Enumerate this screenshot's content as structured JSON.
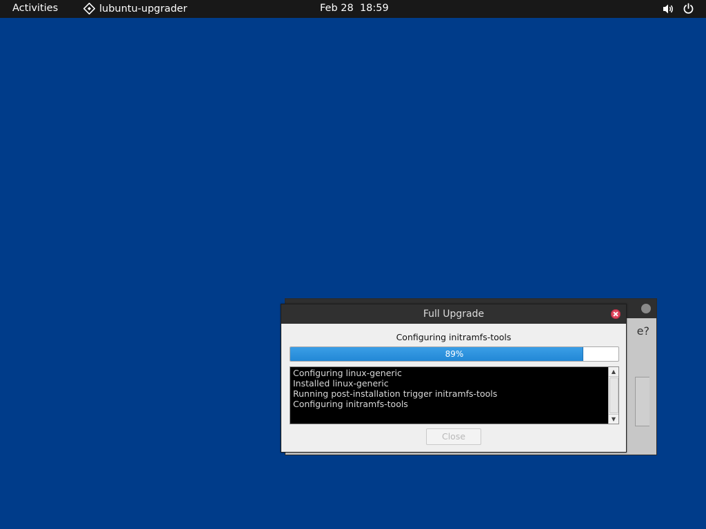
{
  "topbar": {
    "activities_label": "Activities",
    "app_name": "lubuntu-upgrader",
    "app_icon": "diamond-app-icon",
    "date": "Feb 28",
    "time": "18:59",
    "sound_icon": "speaker-icon",
    "power_icon": "power-icon"
  },
  "background_dialog": {
    "visible_text": "e?"
  },
  "dialog": {
    "title": "Full Upgrade",
    "status_text": "Configuring initramfs-tools",
    "progress": {
      "percent": 89,
      "label": "89%"
    },
    "log_lines": [
      "Configuring linux-generic",
      "Installed linux-generic",
      "Running post-installation trigger initramfs-tools",
      "Configuring initramfs-tools"
    ],
    "close_button_label": "Close",
    "close_button_enabled": false
  },
  "colors": {
    "desktop": "#003c8a",
    "topbar": "#181818",
    "progress_fill": "#2b90dd",
    "close_icon": "#e0475e"
  }
}
